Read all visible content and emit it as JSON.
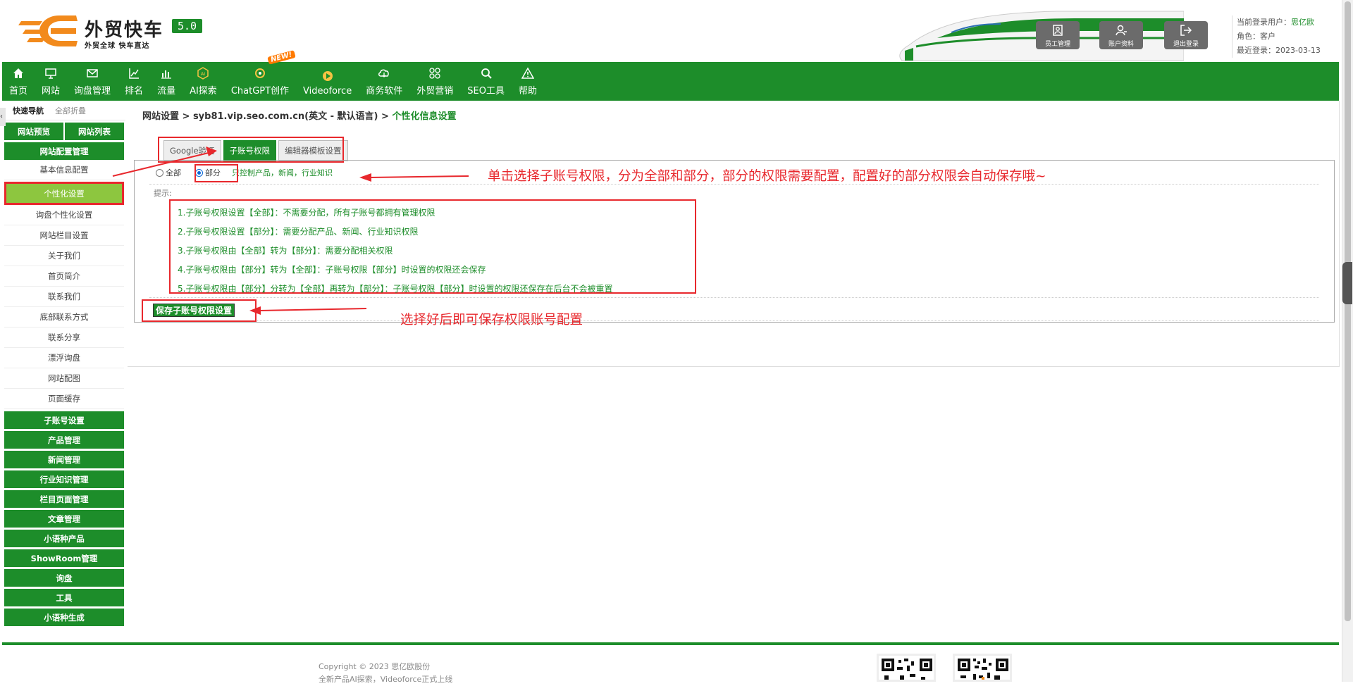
{
  "brand": {
    "title": "外贸快车",
    "version": "5.0",
    "subtitle": "外贸全球 快车直达"
  },
  "header_buttons": [
    {
      "label": "员工管理",
      "icon": "staff-icon"
    },
    {
      "label": "账户资料",
      "icon": "account-icon"
    },
    {
      "label": "退出登录",
      "icon": "logout-icon"
    }
  ],
  "user": {
    "current_label": "当前登录用户：",
    "current_value": "思亿欧",
    "role_label": "角色：",
    "role_value": "客户",
    "last_login_label": "最近登录：",
    "last_login_value": "2023-03-13"
  },
  "nav": [
    {
      "label": "首页",
      "icon": "home-icon"
    },
    {
      "label": "网站",
      "icon": "monitor-icon"
    },
    {
      "label": "询盘管理",
      "icon": "mail-icon"
    },
    {
      "label": "排名",
      "icon": "ranking-icon"
    },
    {
      "label": "流量",
      "icon": "bar-chart-icon"
    },
    {
      "label": "AI探索",
      "icon": "ai-icon"
    },
    {
      "label": "ChatGPT创作",
      "icon": "chatgpt-icon",
      "badge": "NEW!"
    },
    {
      "label": "Videoforce",
      "icon": "videoforce-icon"
    },
    {
      "label": "商务软件",
      "icon": "software-icon"
    },
    {
      "label": "外贸营销",
      "icon": "marketing-icon"
    },
    {
      "label": "SEO工具",
      "icon": "search-icon"
    },
    {
      "label": "帮助",
      "icon": "warning-icon"
    }
  ],
  "sidebar": {
    "quick_nav": "快速导航",
    "collapse_all": "全部折叠",
    "preview": "网站预览",
    "site_list": "网站列表",
    "config_group": "网站配置管理",
    "config_items": [
      "基本信息配置",
      "个性化设置",
      "询盘个性化设置",
      "网站栏目设置",
      "关于我们",
      "首页简介",
      "联系我们",
      "底部联系方式",
      "联系分享",
      "漂浮询盘",
      "网站配图",
      "页面缓存"
    ],
    "active_item": "个性化设置",
    "groups": [
      "子账号设置",
      "产品管理",
      "新闻管理",
      "行业知识管理",
      "栏目页面管理",
      "文章管理",
      "小语种产品",
      "ShowRoom管理",
      "询盘",
      "工具",
      "小语种生成"
    ]
  },
  "breadcrumb": {
    "path": "网站设置 > syb81.vip.seo.com.cn(英文 - 默认语言) > ",
    "current": "个性化信息设置"
  },
  "tabs": [
    "Google验证",
    "子账号权限",
    "编辑器模板设置"
  ],
  "permission": {
    "option_all": "全部",
    "option_part": "部分",
    "hint": "只控制产品，新闻，行业知识",
    "tip_label": "提示:",
    "tips": [
      "1.子账号权限设置【全部】：不需要分配，所有子账号都拥有管理权限",
      "2.子账号权限设置【部分】：需要分配产品、新闻、行业知识权限",
      "3.子账号权限由【全部】转为【部分】：需要分配相关权限",
      "4.子账号权限由【部分】转为【全部】：子账号权限【部分】时设置的权限还会保存",
      "5.子账号权限由【部分】分转为【全部】再转为【部分】：子账号权限【部分】时设置的权限还保存在后台不会被重置"
    ],
    "save_label": "保存子账号权限设置"
  },
  "annotations": {
    "radio_note": "单击选择子账号权限，分为全部和部分，部分的权限需要配置，配置好的部分权限会自动保存哦~",
    "save_note": "选择好后即可保存权限账号配置"
  },
  "footer": {
    "copyright": "Copyright © 2023 思亿欧股份",
    "news": "全新产品AI探索，Videoforce正式上线"
  },
  "colors": {
    "brand_green": "#1d8d2a",
    "highlight_green": "#8dc63f",
    "annotation_red": "#e8282d",
    "logo_orange": "#f28a1c"
  }
}
